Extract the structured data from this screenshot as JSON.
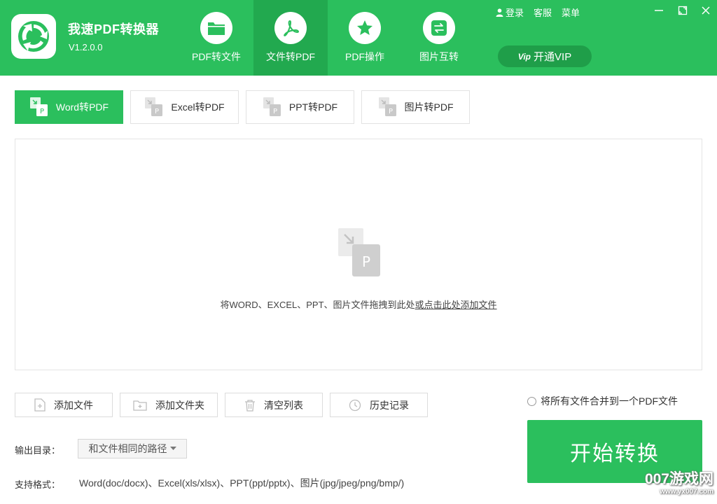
{
  "app": {
    "title": "我速PDF转换器",
    "version": "V1.2.0.0"
  },
  "nav": [
    {
      "label": "PDF转文件",
      "icon": "folder-icon"
    },
    {
      "label": "文件转PDF",
      "icon": "pdf-acrobat-icon",
      "active": true
    },
    {
      "label": "PDF操作",
      "icon": "star-icon"
    },
    {
      "label": "图片互转",
      "icon": "swap-icon"
    }
  ],
  "top_links": {
    "login": "登录",
    "service": "客服",
    "menu": "菜单"
  },
  "vip": {
    "badge": "Vip",
    "label": "开通VIP"
  },
  "subtabs": [
    {
      "label": "Word转PDF",
      "active": true
    },
    {
      "label": "Excel转PDF"
    },
    {
      "label": "PPT转PDF"
    },
    {
      "label": "图片转PDF"
    }
  ],
  "dropzone": {
    "text": "将WORD、EXCEL、PPT、图片文件拖拽到此处",
    "link": "或点击此处添加文件",
    "icon_letter": "P"
  },
  "actions": [
    {
      "label": "添加文件",
      "icon": "add-file-icon"
    },
    {
      "label": "添加文件夹",
      "icon": "add-folder-icon"
    },
    {
      "label": "清空列表",
      "icon": "trash-icon"
    },
    {
      "label": "历史记录",
      "icon": "clock-icon"
    }
  ],
  "merge_option": {
    "label": "将所有文件合并到一个PDF文件",
    "checked": false
  },
  "start_button": "开始转换",
  "output": {
    "label": "输出目录：",
    "value": "和文件相同的路径"
  },
  "formats": {
    "label": "支持格式：",
    "text": "Word(doc/docx)、Excel(xls/xlsx)、PPT(ppt/pptx)、图片(jpg/jpeg/png/bmp/)"
  },
  "watermark": {
    "main": "007游戏网",
    "sub": "www.yx007.com"
  },
  "colors": {
    "primary": "#2bbf5d",
    "primary_dark": "#22a94f",
    "vip_bg": "#1f9e49",
    "border": "#e2e2e2"
  }
}
